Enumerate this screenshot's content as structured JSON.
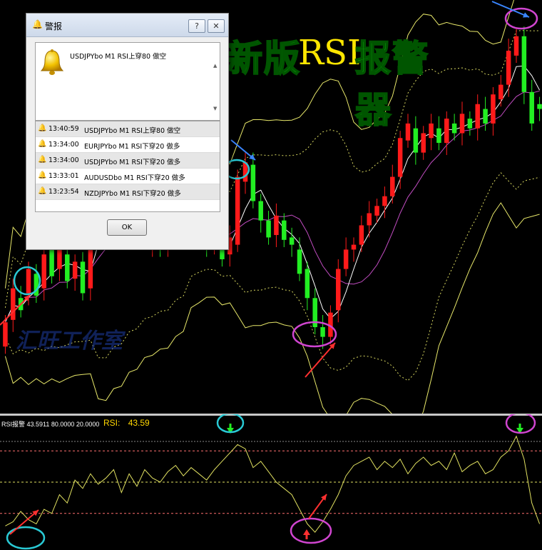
{
  "title_banner": {
    "part1": "新版",
    "part2": "RSI",
    "part3": "报警器"
  },
  "watermark": "汇旺工作室",
  "rsi_panel": {
    "header": "RSI报警 43.5911 80.0000 20.0000",
    "label": "RSI:",
    "value": "43.59"
  },
  "alert_dialog": {
    "title": "警报",
    "help_button": "?",
    "close_button": "✕",
    "current_message": "USDJPYbo M1 RSI上穿80 做空",
    "history": [
      {
        "time": "13:40:59",
        "message": "USDJPYbo M1 RSI上穿80 做空"
      },
      {
        "time": "13:34:00",
        "message": "EURJPYbo M1 RSI下穿20 做多"
      },
      {
        "time": "13:34:00",
        "message": "USDJPYbo M1 RSI下穿20 做多"
      },
      {
        "time": "13:33:01",
        "message": "AUDUSDbo M1 RSI下穿20 做多"
      },
      {
        "time": "13:23:54",
        "message": "NZDJPYbo M1 RSI下穿20 做多"
      }
    ],
    "ok_label": "OK"
  },
  "colors": {
    "bull": "#ff1a1a",
    "bear": "#22ee22",
    "band_outer": "#e8e86a",
    "band_dotted": "#d8d860",
    "ma_white": "#ffffff",
    "ma_magenta": "#c24dc2",
    "rsi_line": "#e0e060",
    "level_line": "#ff6f6f",
    "level_mid": "#e0e060",
    "cyan_marker": "#29c9d4",
    "magenta_marker": "#d045d0",
    "blue_arrow": "#3a86ff",
    "red_arrow": "#ff3030"
  },
  "chart_data": {
    "type": "candlestick",
    "candles": [
      [
        20,
        30
      ],
      [
        31,
        44
      ],
      [
        40,
        35
      ],
      [
        42,
        52
      ],
      [
        50,
        41
      ],
      [
        44,
        58
      ],
      [
        60,
        49
      ],
      [
        52,
        63
      ],
      [
        58,
        47
      ],
      [
        48,
        55
      ],
      [
        55,
        42
      ],
      [
        44,
        60
      ],
      [
        70,
        92
      ],
      [
        90,
        78
      ],
      [
        84,
        72
      ],
      [
        70,
        78
      ],
      [
        76,
        66
      ],
      [
        66,
        74
      ],
      [
        72,
        63
      ],
      [
        62,
        72
      ],
      [
        68,
        60
      ],
      [
        62,
        70
      ],
      [
        64,
        74
      ],
      [
        72,
        65
      ],
      [
        66,
        75
      ],
      [
        73,
        68
      ],
      [
        70,
        60
      ],
      [
        63,
        65
      ],
      [
        62,
        56
      ],
      [
        58,
        65
      ],
      [
        62,
        90
      ],
      [
        88,
        96
      ],
      [
        95,
        80
      ],
      [
        80,
        72
      ],
      [
        72,
        65
      ],
      [
        66,
        74
      ],
      [
        72,
        64
      ],
      [
        65,
        62
      ],
      [
        60,
        50
      ],
      [
        52,
        40
      ],
      [
        40,
        28
      ],
      [
        28,
        24
      ],
      [
        24,
        34
      ],
      [
        35,
        52
      ],
      [
        52,
        60
      ],
      [
        60,
        62
      ],
      [
        62,
        70
      ],
      [
        70,
        75
      ],
      [
        74,
        78
      ],
      [
        78,
        82
      ],
      [
        82,
        90
      ],
      [
        90,
        106
      ],
      [
        105,
        112
      ],
      [
        110,
        100
      ],
      [
        100,
        108
      ],
      [
        106,
        112
      ],
      [
        110,
        104
      ],
      [
        104,
        114
      ],
      [
        112,
        108
      ],
      [
        108,
        116
      ],
      [
        114,
        110
      ],
      [
        110,
        120
      ],
      [
        118,
        112
      ],
      [
        112,
        124
      ],
      [
        122,
        128
      ],
      [
        128,
        142
      ],
      [
        140,
        148
      ],
      [
        148,
        125
      ],
      [
        125,
        112
      ],
      [
        120,
        118
      ]
    ],
    "rsi": [
      8,
      12,
      22,
      14,
      10,
      24,
      20,
      38,
      30,
      52,
      44,
      58,
      48,
      54,
      62,
      40,
      58,
      46,
      62,
      54,
      50,
      60,
      66,
      56,
      64,
      58,
      52,
      62,
      70,
      78,
      86,
      82,
      64,
      70,
      60,
      50,
      44,
      38,
      24,
      10,
      2,
      12,
      24,
      38,
      56,
      66,
      70,
      74,
      62,
      70,
      64,
      72,
      58,
      68,
      74,
      66,
      70,
      62,
      78,
      60,
      66,
      70,
      58,
      62,
      74,
      80,
      94,
      72,
      30,
      10
    ],
    "rsi_levels": [
      80,
      50,
      20
    ],
    "signals": [
      {
        "type": "sell",
        "candle": 67
      },
      {
        "type": "buy",
        "candle": 41
      },
      {
        "type": "sell",
        "candle": 30
      },
      {
        "type": "buy",
        "candle": 2
      }
    ]
  }
}
